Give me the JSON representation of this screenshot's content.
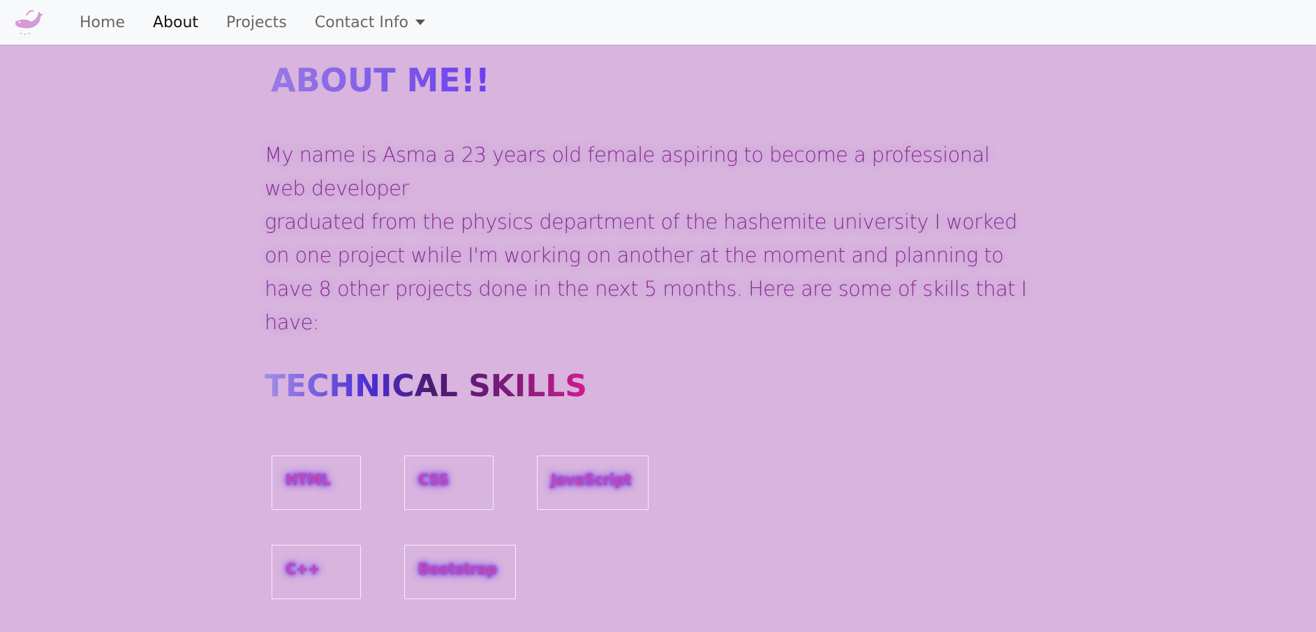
{
  "nav": {
    "brand_icon": "whale-logo-icon",
    "links": [
      {
        "label": "Home"
      },
      {
        "label": "About"
      },
      {
        "label": "Projects"
      },
      {
        "label": "Contact Info"
      }
    ],
    "active": "About"
  },
  "about": {
    "title": "ABOUT ME!!",
    "paragraph_1": "My name is Asma a 23 years old female aspiring to become a professional web developer",
    "paragraph_2": "graduated from the physics department of the hashemite university I worked on one project while I'm working on another at the moment and planning to have 8 other projects done in the next 5 months. Here are some of skills that I have:"
  },
  "skills": {
    "title": "TECHNICAL SKILLS",
    "items": [
      {
        "label": "HTML"
      },
      {
        "label": "CSS"
      },
      {
        "label": "JavaScript"
      },
      {
        "label": "C++"
      },
      {
        "label": "Bootstrap"
      }
    ]
  },
  "colors": {
    "page_background": "#d8b4de",
    "navbar_background": "#f8f9fa",
    "text_purple": "#8a2a8e",
    "skill_text": "#c24aa8",
    "skill_glow": "#7a3cf2"
  }
}
